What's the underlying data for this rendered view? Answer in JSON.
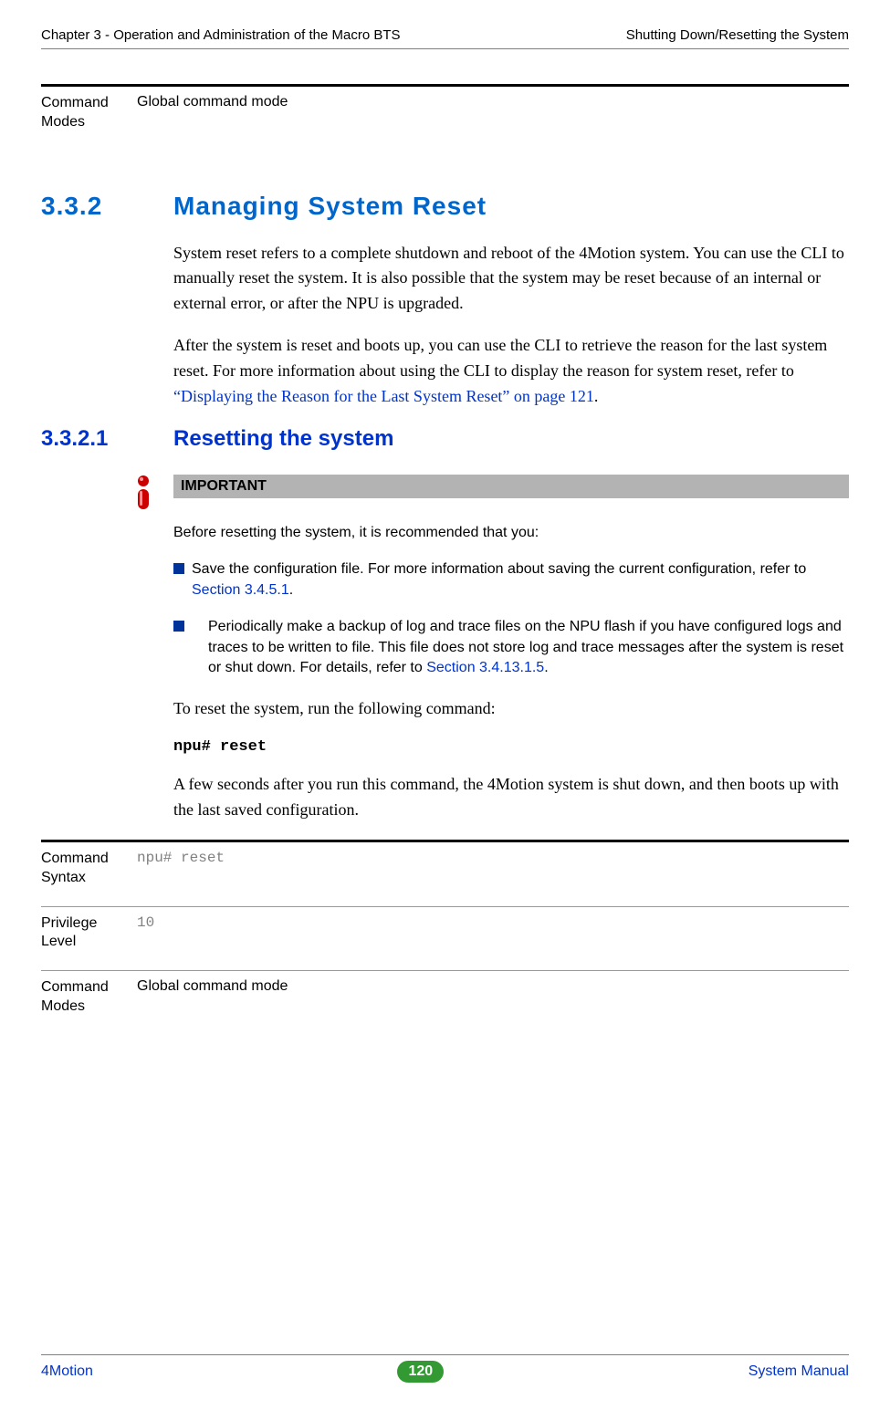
{
  "header": {
    "left": "Chapter 3 - Operation and Administration of the Macro BTS",
    "right": "Shutting Down/Resetting the System"
  },
  "top_table": {
    "rows": [
      {
        "label": "Command Modes",
        "value": "Global command mode",
        "mono": false
      }
    ]
  },
  "section": {
    "num": "3.3.2",
    "title": "Managing System Reset",
    "p1": "System reset refers to a complete shutdown and reboot of the 4Motion system. You can use the CLI to manually reset the system. It is also possible that the system may be reset because of an internal or external error, or after the NPU is upgraded.",
    "p2a": "After the system is reset and boots up, you can use the CLI to retrieve the reason for the last system reset. For more information about using the CLI to display the reason for system reset, refer to ",
    "p2_link": "“Displaying the Reason for the Last System Reset” on page 121",
    "p2b": "."
  },
  "subsection": {
    "num": "3.3.2.1",
    "title": "Resetting the system"
  },
  "important": {
    "label": "IMPORTANT",
    "intro": "Before resetting the system, it is recommended that you:",
    "bullet1a": "Save the configuration file. For more information about saving the current configuration, refer to ",
    "bullet1_link": "Section 3.4.5.1",
    "bullet1b": ".",
    "bullet2a": "Periodically make a backup of log and trace files on the NPU flash if you have configured logs and traces to be written to file. This file does not store log and trace messages after the system is reset or shut down. For details, refer to ",
    "bullet2_link": "Section 3.4.13.1.5",
    "bullet2b": "."
  },
  "after_important": {
    "p1": "To reset the system, run the following command:",
    "cmd": "npu# reset",
    "p2": "A few seconds after you run this command, the 4Motion system is shut down, and then boots up with the last saved configuration."
  },
  "bottom_table": {
    "rows": [
      {
        "label": "Command Syntax",
        "value": "npu# reset",
        "mono": true
      },
      {
        "label": "Privilege Level",
        "value": "10",
        "mono": true
      },
      {
        "label": "Command Modes",
        "value": "Global command mode",
        "mono": false
      }
    ]
  },
  "footer": {
    "left": "4Motion",
    "page": "120",
    "right": "System Manual"
  }
}
